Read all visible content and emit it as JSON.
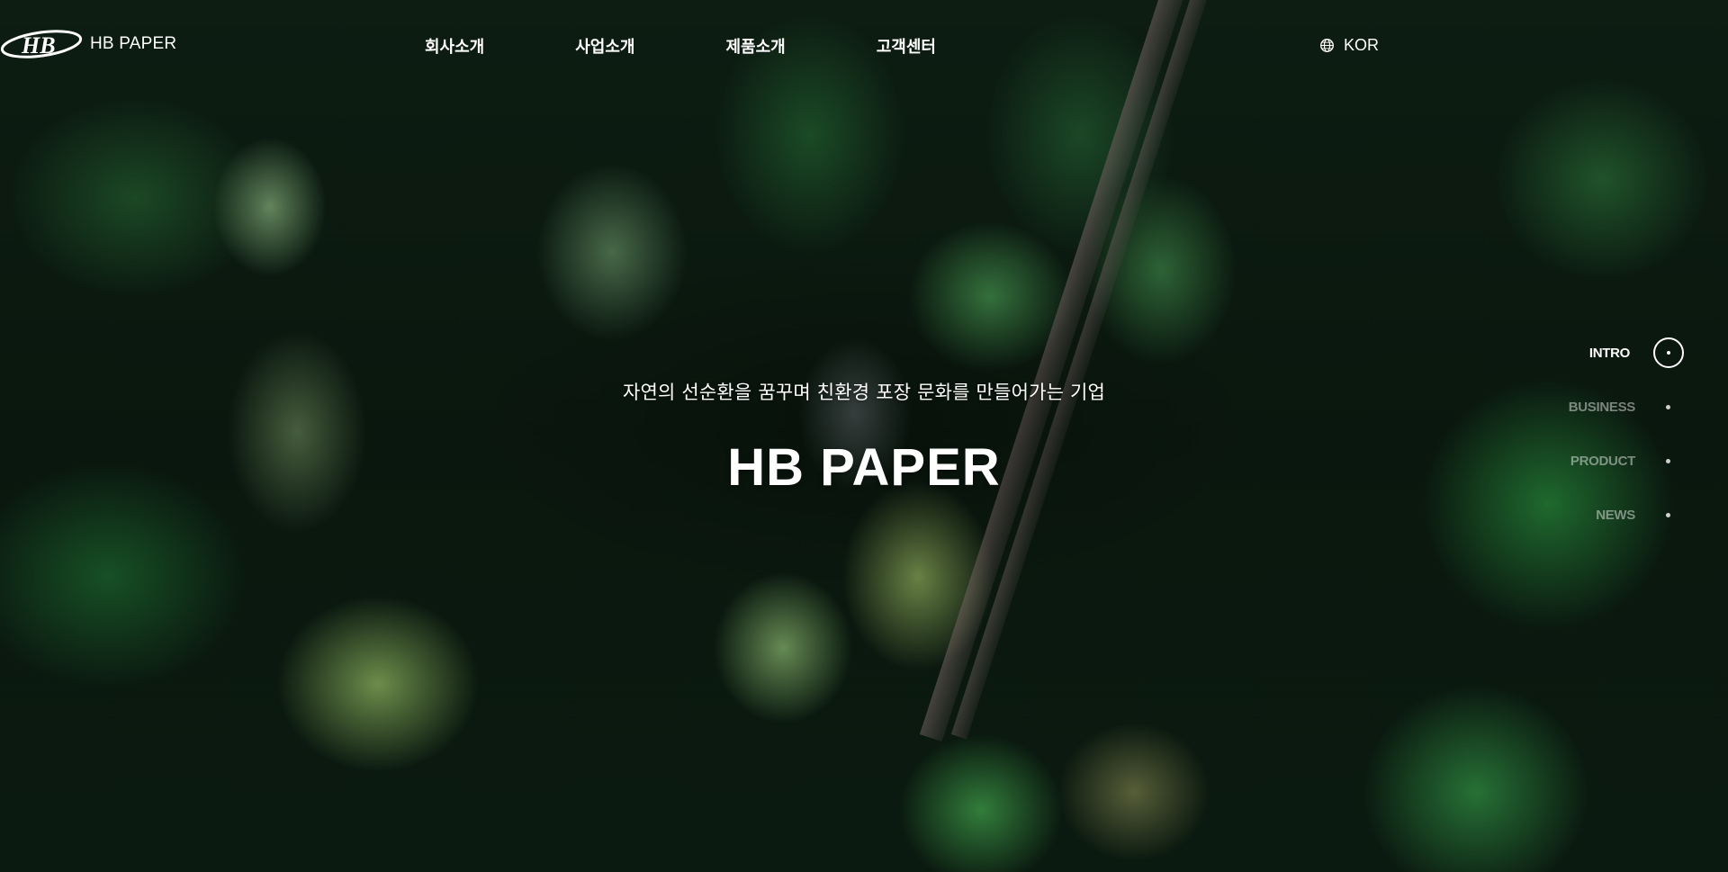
{
  "header": {
    "logo_text": "HB PAPER",
    "nav": [
      {
        "label": "회사소개"
      },
      {
        "label": "사업소개"
      },
      {
        "label": "제품소개"
      },
      {
        "label": "고객센터"
      }
    ],
    "language": {
      "label": "KOR",
      "icon": "globe-icon"
    }
  },
  "hero": {
    "subtitle": "자연의 선순환을 꿈꾸며 친환경 포장 문화를 만들어가는 기업",
    "title": "HB PAPER"
  },
  "section_nav": {
    "items": [
      {
        "label": "INTRO",
        "active": true
      },
      {
        "label": "BUSINESS",
        "active": false
      },
      {
        "label": "PRODUCT",
        "active": false
      },
      {
        "label": "NEWS",
        "active": false
      }
    ]
  },
  "colors": {
    "text": "#ffffff",
    "inactive_nav": "rgba(255,255,255,0.45)",
    "forest_dark": "#0b140d"
  }
}
